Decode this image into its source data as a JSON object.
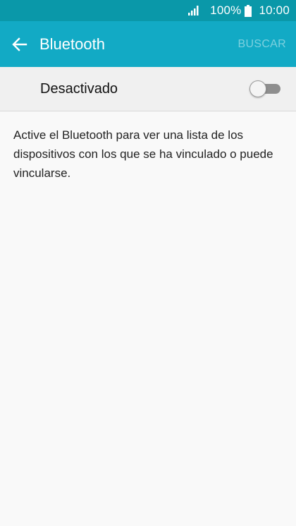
{
  "status_bar": {
    "battery_percent": "100%",
    "time": "10:00",
    "signal_icon": "signal-bars-icon",
    "battery_icon": "battery-icon"
  },
  "app_bar": {
    "back_icon": "arrow-back-icon",
    "title": "Bluetooth",
    "action_label": "BUSCAR"
  },
  "toggle_row": {
    "label": "Desactivado",
    "switch_state": "off"
  },
  "description": "Active el Bluetooth para ver una lista de los dispositivos con los que se ha vinculado o puede vincularse.",
  "colors": {
    "status_bar": "#0a98a9",
    "app_bar": "#12aac5",
    "background": "#f9f9f9",
    "toggle_row_bg": "#f0f0f0"
  }
}
